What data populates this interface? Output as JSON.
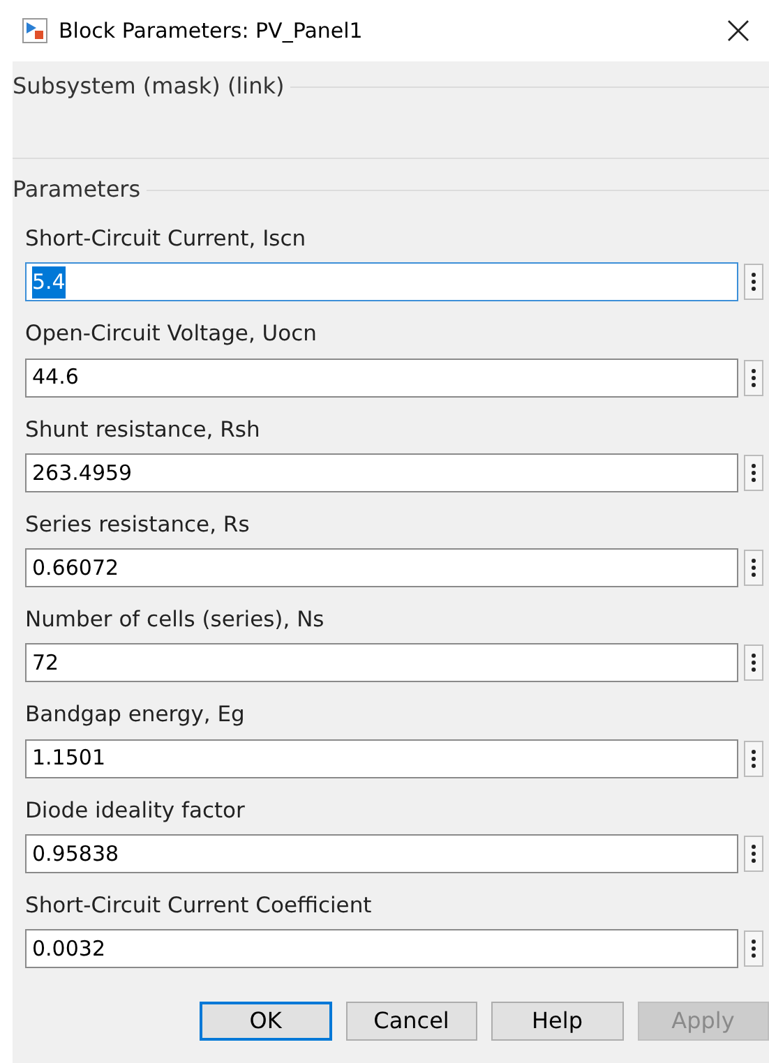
{
  "window": {
    "title": "Block Parameters: PV_Panel1"
  },
  "description_group": {
    "title": "Subsystem (mask) (link)"
  },
  "parameters_group": {
    "title": "Parameters",
    "fields": [
      {
        "label": "Short-Circuit Current, Iscn",
        "value": "5.4",
        "focused": true
      },
      {
        "label": "Open-Circuit Voltage, Uocn",
        "value": "44.6",
        "focused": false
      },
      {
        "label": "Shunt resistance, Rsh",
        "value": "263.4959",
        "focused": false
      },
      {
        "label": "Series resistance, Rs",
        "value": "0.66072",
        "focused": false
      },
      {
        "label": "Number of cells (series), Ns",
        "value": "72",
        "focused": false
      },
      {
        "label": "Bandgap energy, Eg",
        "value": "1.1501",
        "focused": false
      },
      {
        "label": "Diode ideality factor",
        "value": "0.95838",
        "focused": false
      },
      {
        "label": "Short-Circuit Current Coefficient",
        "value": "0.0032",
        "focused": false
      }
    ]
  },
  "buttons": [
    {
      "label": "OK",
      "default": true,
      "disabled": false
    },
    {
      "label": "Cancel",
      "default": false,
      "disabled": false
    },
    {
      "label": "Help",
      "default": false,
      "disabled": false
    },
    {
      "label": "Apply",
      "default": false,
      "disabled": true
    }
  ]
}
